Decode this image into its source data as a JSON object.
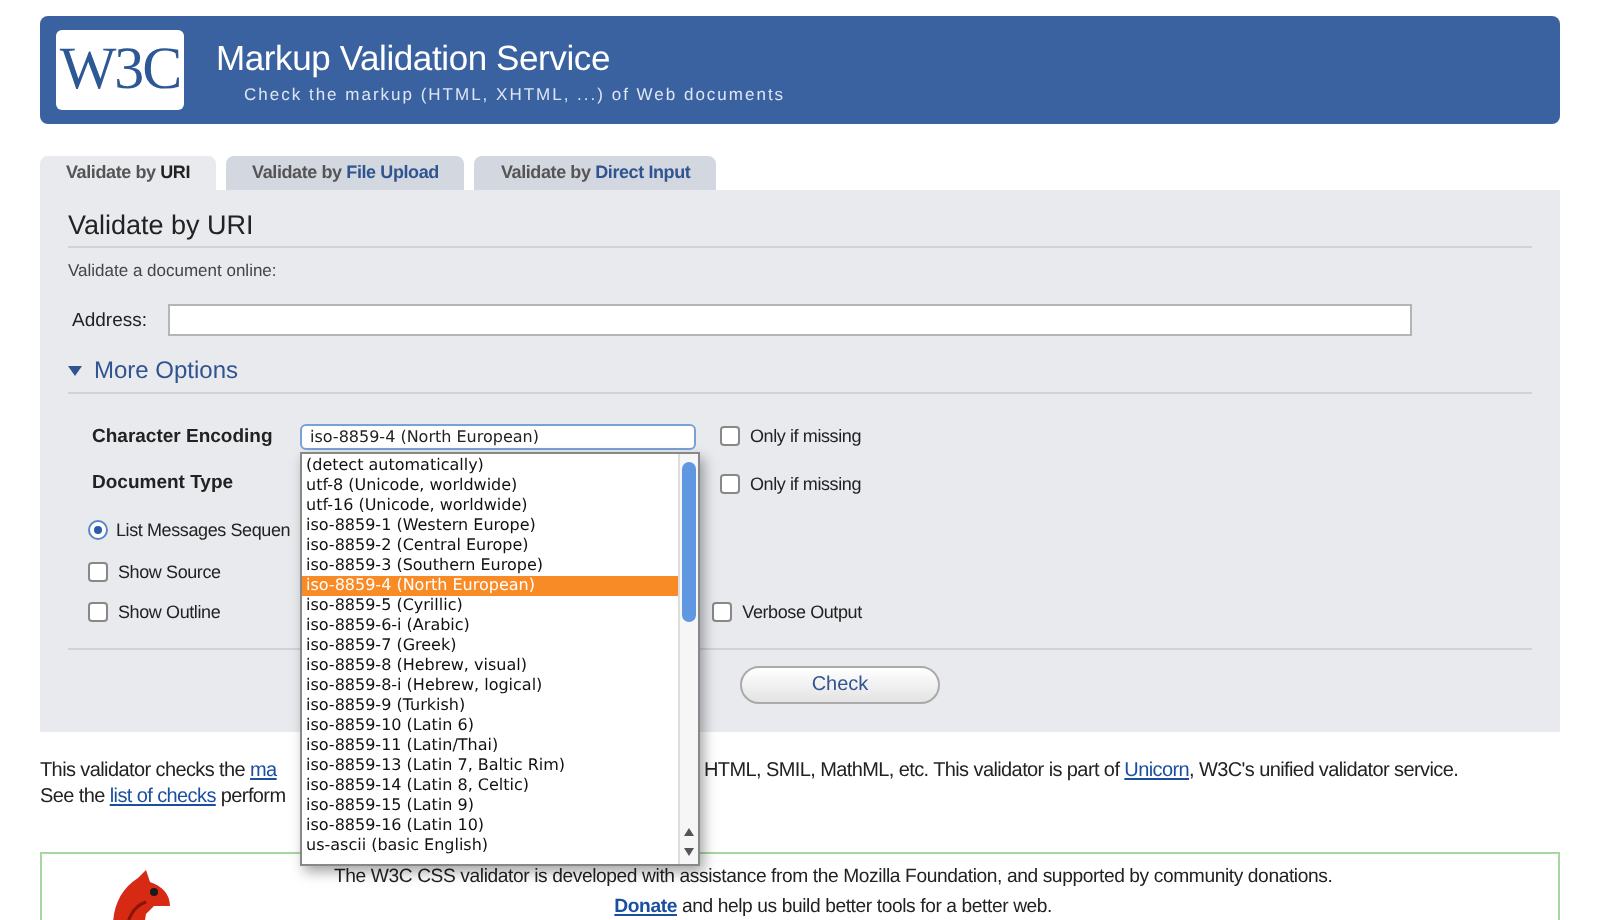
{
  "header": {
    "logo": "W3C",
    "title": "Markup Validation Service",
    "subtitle": "Check the markup (HTML, XHTML, ...) of Web documents"
  },
  "tabs": [
    {
      "prefix": "Validate by ",
      "label": "URI",
      "selected": true
    },
    {
      "prefix": "Validate by ",
      "label": "File Upload",
      "selected": false
    },
    {
      "prefix": "Validate by ",
      "label": "Direct Input",
      "selected": false
    }
  ],
  "form": {
    "heading": "Validate by URI",
    "description": "Validate a document online:",
    "address_label": "Address:",
    "more_options": {
      "label": "More Options",
      "expanded": true
    }
  },
  "options": {
    "encoding": {
      "label": "Character Encoding",
      "value": "iso-8859-4 (North European)",
      "fallback": {
        "label": "Only if missing",
        "checked": false
      }
    },
    "doctype": {
      "label": "Document Type",
      "fallback": {
        "label": "Only if missing",
        "checked": false
      }
    },
    "list_messages": {
      "label": "List Messages Sequen",
      "selected": true
    },
    "show_source": {
      "label": "Show Source",
      "checked": false
    },
    "show_outline": {
      "label": "Show Outline",
      "checked": false
    },
    "verbose": {
      "label": "Verbose Output",
      "checked": false
    }
  },
  "dropdown": [
    {
      "label": "(detect automatically)",
      "selected": false
    },
    {
      "label": "utf-8 (Unicode, worldwide)",
      "selected": false
    },
    {
      "label": "utf-16 (Unicode, worldwide)",
      "selected": false
    },
    {
      "label": "iso-8859-1 (Western Europe)",
      "selected": false
    },
    {
      "label": "iso-8859-2 (Central Europe)",
      "selected": false
    },
    {
      "label": "iso-8859-3 (Southern Europe)",
      "selected": false
    },
    {
      "label": "iso-8859-4 (North European)",
      "selected": true
    },
    {
      "label": "iso-8859-5 (Cyrillic)",
      "selected": false
    },
    {
      "label": "iso-8859-6-i (Arabic)",
      "selected": false
    },
    {
      "label": "iso-8859-7 (Greek)",
      "selected": false
    },
    {
      "label": "iso-8859-8 (Hebrew, visual)",
      "selected": false
    },
    {
      "label": "iso-8859-8-i (Hebrew, logical)",
      "selected": false
    },
    {
      "label": "iso-8859-9 (Turkish)",
      "selected": false
    },
    {
      "label": "iso-8859-10 (Latin 6)",
      "selected": false
    },
    {
      "label": "iso-8859-11 (Latin/Thai)",
      "selected": false
    },
    {
      "label": "iso-8859-13 (Latin 7, Baltic Rim)",
      "selected": false
    },
    {
      "label": "iso-8859-14 (Latin 8, Celtic)",
      "selected": false
    },
    {
      "label": "iso-8859-15 (Latin 9)",
      "selected": false
    },
    {
      "label": "iso-8859-16 (Latin 10)",
      "selected": false
    },
    {
      "label": "us-ascii (basic English)",
      "selected": false
    }
  ],
  "check_button": "Check",
  "about": {
    "line1_start": "This validator checks the ",
    "line1_link": "ma",
    "line1_end_start": "HTML, SMIL, MathML, etc. This validator is part of ",
    "line1_end_link": "Unicorn",
    "line1_end_rest": ", W3C's unified validator service.",
    "line2_start": "See the ",
    "line2_link": "list of checks",
    "line2_rest": " perform"
  },
  "sponsor": {
    "text": "The W3C CSS validator is developed with assistance from the Mozilla Foundation, and supported by community donations.",
    "donate": "Donate",
    "rest": " and help us build better tools for a better web."
  }
}
